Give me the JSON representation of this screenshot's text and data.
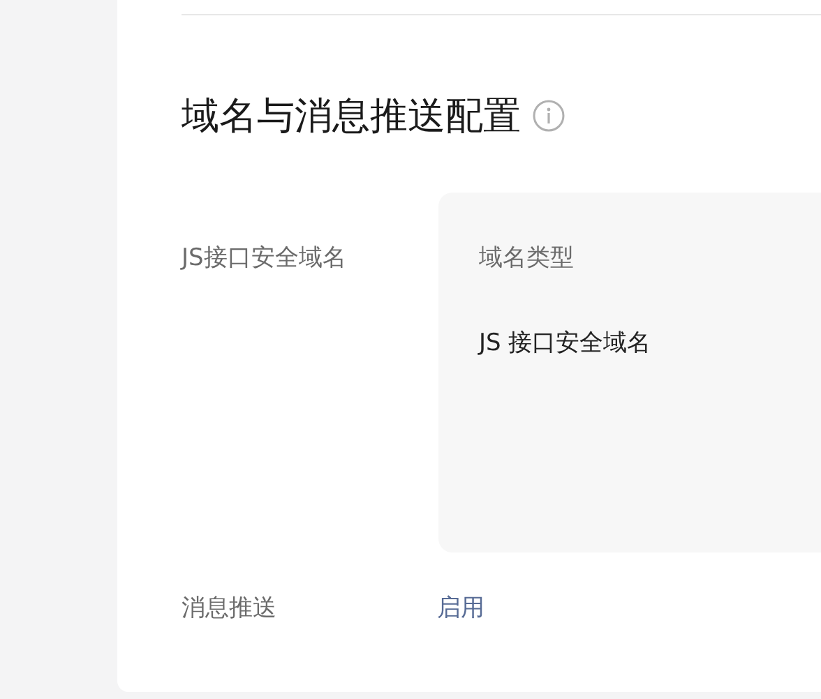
{
  "section": {
    "title": "域名与消息推送配置"
  },
  "domain_row": {
    "label": "JS接口安全域名",
    "panel": {
      "column_header": "域名类型",
      "value": "JS 接口安全域名"
    }
  },
  "push_row": {
    "label": "消息推送",
    "action": "启用"
  }
}
